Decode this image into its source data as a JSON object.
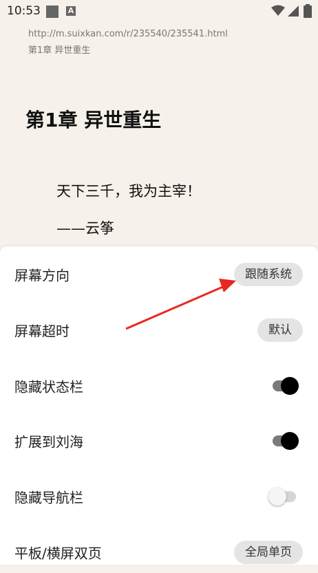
{
  "status_bar": {
    "time": "10:53",
    "icons": [
      "square-notification-icon",
      "a-notification-icon",
      "wifi-icon",
      "signal-icon",
      "battery-icon"
    ],
    "a_glyph": "A"
  },
  "reader": {
    "url": "http://m.suixkan.com/r/235540/235541.html",
    "subtitle": "第1章 异世重生",
    "chapter_title": "第1章 异世重生",
    "paragraphs": [
      "天下三千，我为主宰！",
      "——云筝"
    ],
    "background": "#f6f1ea"
  },
  "settings": {
    "items": [
      {
        "label": "屏幕方向",
        "control": "pill",
        "value": "跟随系统"
      },
      {
        "label": "屏幕超时",
        "control": "pill",
        "value": "默认"
      },
      {
        "label": "隐藏状态栏",
        "control": "switch",
        "on": true
      },
      {
        "label": "扩展到刘海",
        "control": "switch",
        "on": true
      },
      {
        "label": "隐藏导航栏",
        "control": "switch",
        "on": false
      },
      {
        "label": "平板/横屏双页",
        "control": "pill",
        "value": "全局单页"
      }
    ]
  },
  "annotation": {
    "type": "arrow",
    "color": "#e8281e",
    "points_to": "跟随系统"
  }
}
